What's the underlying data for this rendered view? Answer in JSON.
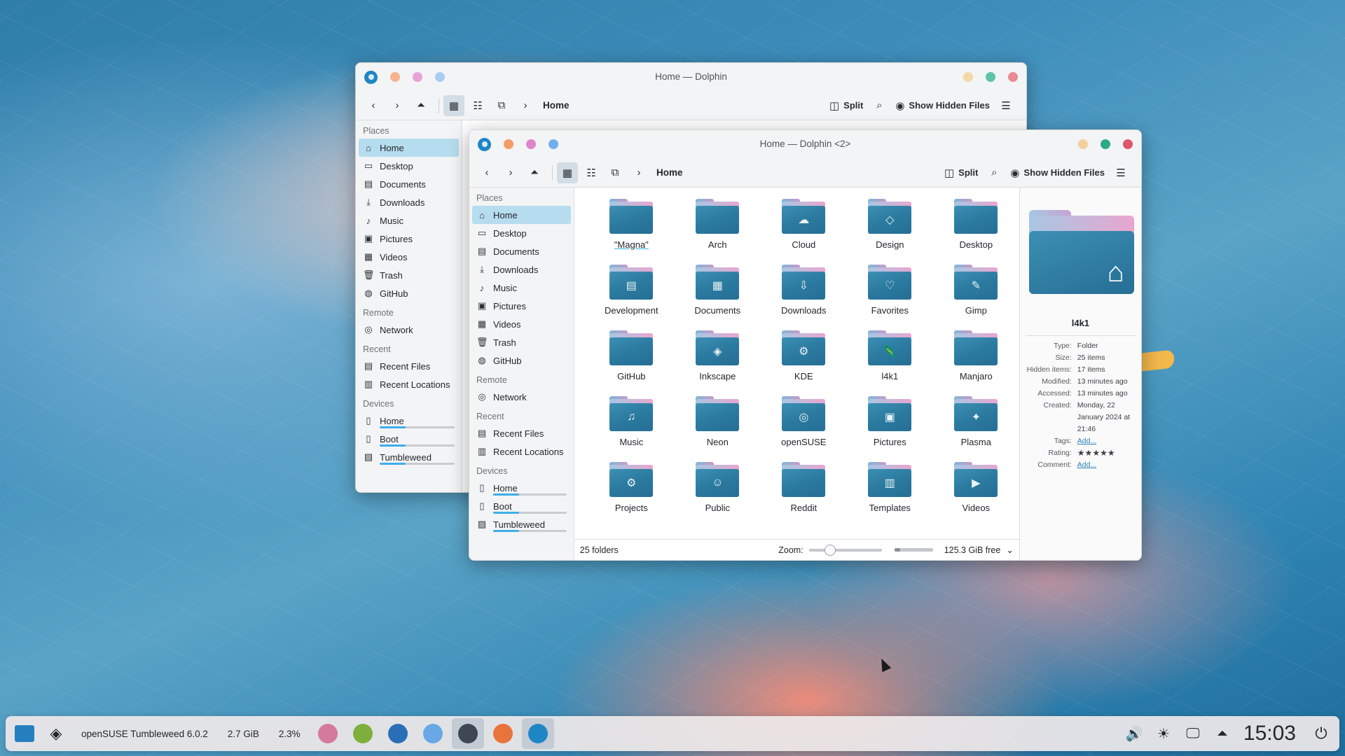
{
  "colors": {
    "accent": "#3daee9",
    "selection": "#b6dcef",
    "folder_front": "#2b7aa0",
    "dot_orange": "#f6b38b",
    "dot_pink": "#e7a3d5",
    "dot_blue": "#7fb7ea",
    "dot_yellow": "#f3d3a3",
    "dot_green": "#3db09a",
    "dot_red": "#e66a78"
  },
  "back_window": {
    "title": "Home — Dolphin",
    "breadcrumb": "Home",
    "split_label": "Split",
    "hidden_label": "Show Hidden Files",
    "sidebar": [
      {
        "section": "Places",
        "items": [
          {
            "label": "Home",
            "icon": "home-icon",
            "selected": true
          },
          {
            "label": "Desktop",
            "icon": "desktop-icon"
          },
          {
            "label": "Documents",
            "icon": "documents-icon"
          },
          {
            "label": "Downloads",
            "icon": "download-icon"
          },
          {
            "label": "Music",
            "icon": "music-icon"
          },
          {
            "label": "Pictures",
            "icon": "pictures-icon"
          },
          {
            "label": "Videos",
            "icon": "videos-icon"
          },
          {
            "label": "Trash",
            "icon": "trash-icon"
          },
          {
            "label": "GitHub",
            "icon": "github-icon"
          }
        ]
      },
      {
        "section": "Remote",
        "items": [
          {
            "label": "Network",
            "icon": "network-icon"
          }
        ]
      },
      {
        "section": "Recent",
        "items": [
          {
            "label": "Recent Files",
            "icon": "recent-files-icon"
          },
          {
            "label": "Recent Locations",
            "icon": "recent-locations-icon"
          }
        ]
      },
      {
        "section": "Devices",
        "items": [
          {
            "label": "Home",
            "icon": "drive-icon",
            "device": true
          },
          {
            "label": "Boot",
            "icon": "drive-icon",
            "device": true
          },
          {
            "label": "Tumbleweed",
            "icon": "encrypted-drive-icon",
            "device": true
          }
        ]
      }
    ]
  },
  "front_window": {
    "title": "Home — Dolphin <2>",
    "breadcrumb": "Home",
    "split_label": "Split",
    "hidden_label": "Show Hidden Files",
    "sidebar": [
      {
        "section": "Places",
        "items": [
          {
            "label": "Home",
            "icon": "home-icon",
            "selected": true
          },
          {
            "label": "Desktop",
            "icon": "desktop-icon"
          },
          {
            "label": "Documents",
            "icon": "documents-icon"
          },
          {
            "label": "Downloads",
            "icon": "download-icon"
          },
          {
            "label": "Music",
            "icon": "music-icon"
          },
          {
            "label": "Pictures",
            "icon": "pictures-icon"
          },
          {
            "label": "Videos",
            "icon": "videos-icon"
          },
          {
            "label": "Trash",
            "icon": "trash-icon"
          },
          {
            "label": "GitHub",
            "icon": "github-icon"
          }
        ]
      },
      {
        "section": "Remote",
        "items": [
          {
            "label": "Network",
            "icon": "network-icon"
          }
        ]
      },
      {
        "section": "Recent",
        "items": [
          {
            "label": "Recent Files",
            "icon": "recent-files-icon"
          },
          {
            "label": "Recent Locations",
            "icon": "recent-locations-icon"
          }
        ]
      },
      {
        "section": "Devices",
        "items": [
          {
            "label": "Home",
            "icon": "drive-icon",
            "device": true
          },
          {
            "label": "Boot",
            "icon": "drive-icon",
            "device": true
          },
          {
            "label": "Tumbleweed",
            "icon": "encrypted-drive-icon",
            "device": true
          }
        ]
      }
    ],
    "folders": [
      {
        "name": "\"Magna\"",
        "emblem": "",
        "current": true
      },
      {
        "name": "Arch",
        "emblem": ""
      },
      {
        "name": "Cloud",
        "emblem": "☁"
      },
      {
        "name": "Design",
        "emblem": "◇"
      },
      {
        "name": "Desktop",
        "emblem": ""
      },
      {
        "name": "Development",
        "emblem": "▤"
      },
      {
        "name": "Documents",
        "emblem": "▦"
      },
      {
        "name": "Downloads",
        "emblem": "⇩"
      },
      {
        "name": "Favorites",
        "emblem": "♡"
      },
      {
        "name": "Gimp",
        "emblem": "✎"
      },
      {
        "name": "GitHub",
        "emblem": ""
      },
      {
        "name": "Inkscape",
        "emblem": "◈"
      },
      {
        "name": "KDE",
        "emblem": "⚙"
      },
      {
        "name": "l4k1",
        "emblem": "🦎"
      },
      {
        "name": "Manjaro",
        "emblem": ""
      },
      {
        "name": "Music",
        "emblem": "♫"
      },
      {
        "name": "Neon",
        "emblem": ""
      },
      {
        "name": "openSUSE",
        "emblem": "◎"
      },
      {
        "name": "Pictures",
        "emblem": "▣"
      },
      {
        "name": "Plasma",
        "emblem": "✦"
      },
      {
        "name": "Projects",
        "emblem": "⚙"
      },
      {
        "name": "Public",
        "emblem": "☺"
      },
      {
        "name": "Reddit",
        "emblem": ""
      },
      {
        "name": "Templates",
        "emblem": "▥"
      },
      {
        "name": "Videos",
        "emblem": "▶"
      }
    ],
    "status": {
      "count": "25 folders",
      "zoom_label": "Zoom:",
      "zoom_value": 0.25,
      "free_space": "125.3 GiB free",
      "used_fraction": 0.15
    },
    "info": {
      "name": "l4k1",
      "rows": [
        {
          "k": "Type:",
          "v": "Folder"
        },
        {
          "k": "Size:",
          "v": "25 items"
        },
        {
          "k": "Hidden items:",
          "v": "17 items"
        },
        {
          "k": "Modified:",
          "v": "13 minutes ago"
        },
        {
          "k": "Accessed:",
          "v": "13 minutes ago"
        },
        {
          "k": "Created:",
          "v": "Monday, 22 January 2024 at 21:46"
        },
        {
          "k": "Tags:",
          "v": "Add...",
          "link": true
        },
        {
          "k": "Rating:",
          "v": "★★★★★",
          "stars": true
        },
        {
          "k": "Comment:",
          "v": "Add...",
          "link": true
        }
      ]
    }
  },
  "taskbar": {
    "distro_label": "openSUSE Tumbleweed 6.0.2",
    "mem_label": "2.7 GiB",
    "cpu_label": "2.3%",
    "apps": [
      {
        "name": "app-pink",
        "color": "#d47a9a"
      },
      {
        "name": "app-gecko",
        "color": "#7fae3c"
      },
      {
        "name": "app-monitor",
        "color": "#2a6fb6"
      },
      {
        "name": "app-store",
        "color": "#6aa7e6"
      },
      {
        "name": "app-system",
        "color": "#3f4852",
        "active": true
      },
      {
        "name": "app-firefox",
        "color": "#e8743b"
      },
      {
        "name": "app-dolphin",
        "color": "#1f86c6",
        "active": true
      }
    ],
    "clock": "15:03"
  }
}
